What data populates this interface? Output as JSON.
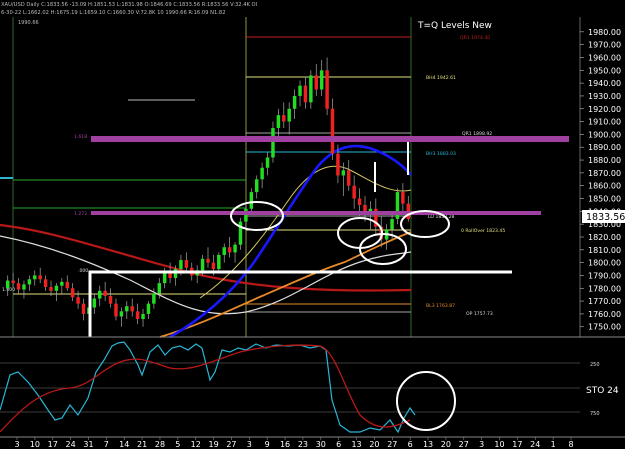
{
  "header": {
    "line1": "XAU/USD Daily  C:1833.56  -13.09  H:1851.53  L:1831.98  O:1846.69  C:1833.56  R:1833.56  V:32.4K  OI",
    "line2": "6-30-22  L:1662.02  H:1675.19  L:1659.10  C:1660.30  V:72.8K  10  1990.66  R:16.09  N1.82",
    "small_label": "1990.66"
  },
  "title": "T=Q Levels New",
  "price_axis": {
    "ticks": [
      "1980.00",
      "1970.00",
      "1960.00",
      "1950.00",
      "1940.00",
      "1930.00",
      "1920.00",
      "1910.00",
      "1900.00",
      "1890.00",
      "1880.00",
      "1870.00",
      "1860.00",
      "1850.00",
      "1840.00",
      "1830.00",
      "1820.00",
      "1810.00",
      "1800.00",
      "1790.00",
      "1780.00",
      "1770.00",
      "1760.00",
      "1750.00"
    ],
    "current": "1833.56"
  },
  "level_labels": {
    "r1": "QR1 1974.30",
    "r2": "BH4 1942.61",
    "r3": "QR1 1898.92",
    "r4": "BH3 1883.03",
    "r5": "LO 1833.28",
    "r6": "0 RollOver 1823.45",
    "r7": "BL3 1763.87",
    "r8": "OP 1757.73",
    "left1": "1.618",
    "left2": "1.272",
    "left3": ".000",
    "left4": "1.000"
  },
  "indicator": {
    "label": "STO 24",
    "ticks": [
      "250",
      "750"
    ]
  },
  "time_axis": {
    "labels": [
      "3",
      "10",
      "17",
      "24",
      "31",
      "7",
      "14",
      "21",
      "28",
      "5",
      "12",
      "19",
      "27",
      "3",
      "9",
      "16",
      "23",
      "30",
      "6",
      "13",
      "20",
      "27",
      "6",
      "13",
      "20",
      "27",
      "3",
      "10",
      "17",
      "24",
      "1",
      "8"
    ]
  },
  "colors": {
    "up": "#22dd22",
    "down": "#ee2222",
    "magenta": "#a040a0",
    "blue": "#1818ff",
    "cyan": "#29b6d6",
    "ma_red": "#b81818",
    "ma_orange": "#e88a28",
    "ma_white": "#dddddd",
    "ma_yellow": "#d8c860"
  },
  "chart_data": {
    "type": "candlestick",
    "symbol": "XAU/USD",
    "y_range": [
      1742,
      1990
    ],
    "candles": [
      [
        1780,
        1790,
        1774,
        1786
      ],
      [
        1786,
        1792,
        1780,
        1784
      ],
      [
        1784,
        1788,
        1776,
        1779
      ],
      [
        1779,
        1786,
        1772,
        1783
      ],
      [
        1783,
        1790,
        1778,
        1787
      ],
      [
        1787,
        1794,
        1782,
        1790
      ],
      [
        1790,
        1796,
        1784,
        1787
      ],
      [
        1787,
        1790,
        1778,
        1781
      ],
      [
        1781,
        1786,
        1774,
        1778
      ],
      [
        1778,
        1784,
        1770,
        1782
      ],
      [
        1782,
        1788,
        1776,
        1785
      ],
      [
        1785,
        1790,
        1778,
        1780
      ],
      [
        1780,
        1784,
        1770,
        1773
      ],
      [
        1773,
        1778,
        1764,
        1768
      ],
      [
        1768,
        1772,
        1755,
        1760
      ],
      [
        1760,
        1768,
        1752,
        1765
      ],
      [
        1765,
        1776,
        1760,
        1772
      ],
      [
        1772,
        1782,
        1766,
        1778
      ],
      [
        1778,
        1785,
        1770,
        1774
      ],
      [
        1774,
        1780,
        1765,
        1768
      ],
      [
        1768,
        1772,
        1755,
        1758
      ],
      [
        1758,
        1765,
        1750,
        1762
      ],
      [
        1762,
        1770,
        1756,
        1766
      ],
      [
        1766,
        1772,
        1758,
        1762
      ],
      [
        1762,
        1768,
        1752,
        1756
      ],
      [
        1756,
        1764,
        1750,
        1760
      ],
      [
        1760,
        1770,
        1756,
        1768
      ],
      [
        1768,
        1780,
        1764,
        1776
      ],
      [
        1776,
        1788,
        1772,
        1784
      ],
      [
        1784,
        1796,
        1780,
        1792
      ],
      [
        1792,
        1800,
        1784,
        1788
      ],
      [
        1788,
        1798,
        1782,
        1795
      ],
      [
        1795,
        1806,
        1790,
        1802
      ],
      [
        1802,
        1808,
        1792,
        1796
      ],
      [
        1796,
        1800,
        1786,
        1790
      ],
      [
        1790,
        1798,
        1784,
        1794
      ],
      [
        1794,
        1806,
        1790,
        1803
      ],
      [
        1803,
        1812,
        1796,
        1800
      ],
      [
        1800,
        1806,
        1790,
        1795
      ],
      [
        1795,
        1808,
        1792,
        1806
      ],
      [
        1806,
        1815,
        1800,
        1812
      ],
      [
        1812,
        1820,
        1804,
        1808
      ],
      [
        1808,
        1816,
        1800,
        1814
      ],
      [
        1814,
        1835,
        1810,
        1832
      ],
      [
        1832,
        1845,
        1826,
        1842
      ],
      [
        1842,
        1858,
        1838,
        1855
      ],
      [
        1855,
        1868,
        1850,
        1865
      ],
      [
        1865,
        1878,
        1858,
        1874
      ],
      [
        1874,
        1886,
        1868,
        1882
      ],
      [
        1882,
        1910,
        1878,
        1905
      ],
      [
        1905,
        1920,
        1896,
        1915
      ],
      [
        1915,
        1925,
        1905,
        1910
      ],
      [
        1910,
        1925,
        1900,
        1920
      ],
      [
        1920,
        1935,
        1912,
        1930
      ],
      [
        1930,
        1942,
        1922,
        1938
      ],
      [
        1938,
        1945,
        1920,
        1925
      ],
      [
        1925,
        1950,
        1920,
        1946
      ],
      [
        1946,
        1955,
        1930,
        1935
      ],
      [
        1935,
        1958,
        1930,
        1950
      ],
      [
        1950,
        1960,
        1915,
        1920
      ],
      [
        1920,
        1928,
        1880,
        1885
      ],
      [
        1885,
        1892,
        1862,
        1868
      ],
      [
        1868,
        1878,
        1852,
        1872
      ],
      [
        1872,
        1880,
        1856,
        1860
      ],
      [
        1860,
        1868,
        1842,
        1850
      ],
      [
        1850,
        1858,
        1836,
        1845
      ],
      [
        1845,
        1852,
        1832,
        1838
      ],
      [
        1838,
        1848,
        1825,
        1842
      ],
      [
        1842,
        1850,
        1822,
        1828
      ],
      [
        1828,
        1836,
        1812,
        1818
      ],
      [
        1818,
        1830,
        1810,
        1826
      ],
      [
        1826,
        1840,
        1818,
        1834
      ],
      [
        1834,
        1858,
        1830,
        1855
      ],
      [
        1855,
        1862,
        1840,
        1846
      ],
      [
        1846,
        1852,
        1832,
        1834
      ]
    ]
  }
}
